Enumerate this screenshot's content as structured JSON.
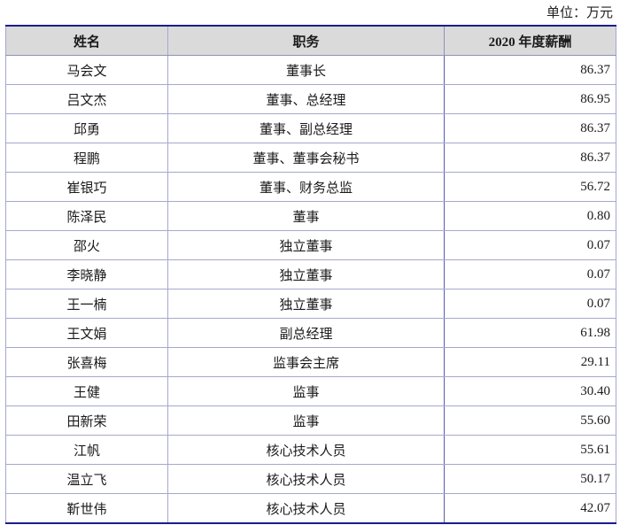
{
  "unit_label": "单位：万元",
  "table": {
    "headers": {
      "name": "姓名",
      "title": "职务",
      "pay": "2020 年度薪酬"
    },
    "rows": [
      {
        "name": "马会文",
        "title": "董事长",
        "pay": "86.37"
      },
      {
        "name": "吕文杰",
        "title": "董事、总经理",
        "pay": "86.95"
      },
      {
        "name": "邱勇",
        "title": "董事、副总经理",
        "pay": "86.37"
      },
      {
        "name": "程鹏",
        "title": "董事、董事会秘书",
        "pay": "86.37"
      },
      {
        "name": "崔银巧",
        "title": "董事、财务总监",
        "pay": "56.72"
      },
      {
        "name": "陈泽民",
        "title": "董事",
        "pay": "0.80"
      },
      {
        "name": "邵火",
        "title": "独立董事",
        "pay": "0.07"
      },
      {
        "name": "李晓静",
        "title": "独立董事",
        "pay": "0.07"
      },
      {
        "name": "王一楠",
        "title": "独立董事",
        "pay": "0.07"
      },
      {
        "name": "王文娟",
        "title": "副总经理",
        "pay": "61.98"
      },
      {
        "name": "张喜梅",
        "title": "监事会主席",
        "pay": "29.11"
      },
      {
        "name": "王健",
        "title": "监事",
        "pay": "30.40"
      },
      {
        "name": "田新荣",
        "title": "监事",
        "pay": "55.60"
      },
      {
        "name": "江帆",
        "title": "核心技术人员",
        "pay": "55.61"
      },
      {
        "name": "温立飞",
        "title": "核心技术人员",
        "pay": "50.17"
      },
      {
        "name": "靳世伟",
        "title": "核心技术人员",
        "pay": "42.07"
      }
    ]
  }
}
